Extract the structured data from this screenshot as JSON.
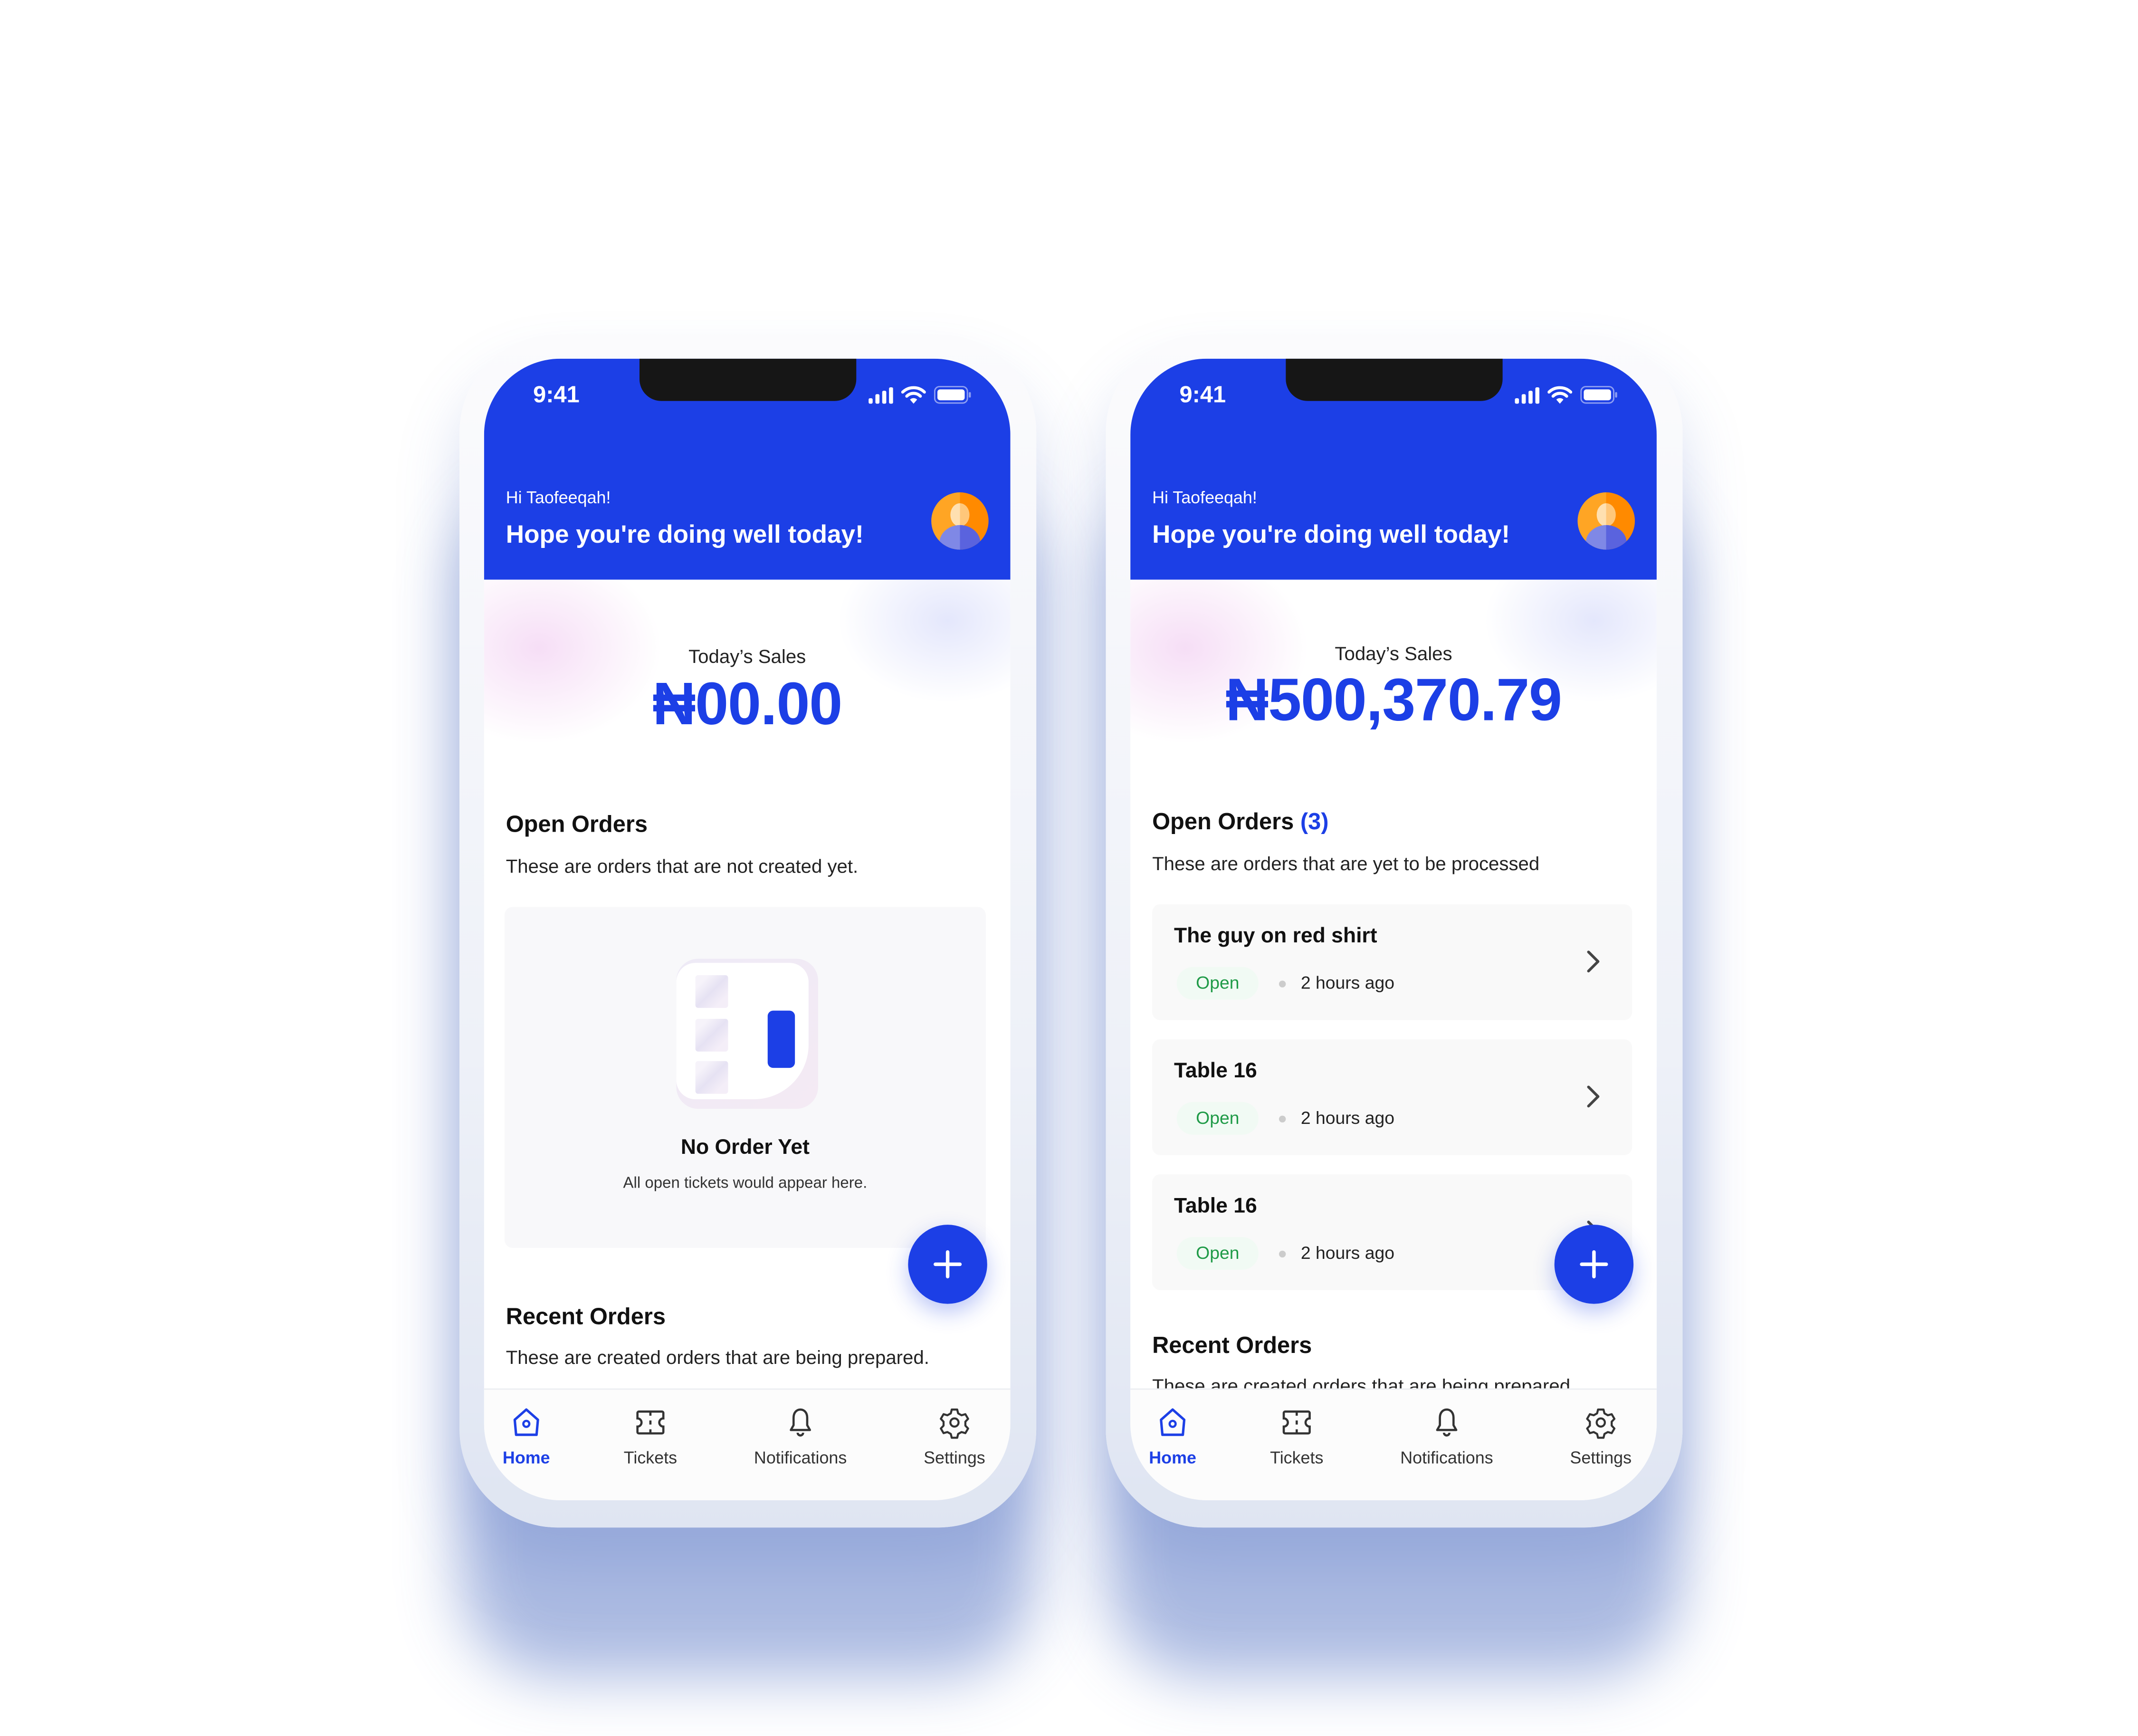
{
  "colors": {
    "brand": "#1c3fe6",
    "open_badge_text": "#1f9a47",
    "open_badge_bg": "#f1faf4"
  },
  "phones": [
    {
      "status_time": "9:41",
      "greeting": "Hi Taofeeqah!",
      "headline": "Hope you're doing well today!",
      "sales_label": "Today’s Sales",
      "sales_amount": "₦00.00",
      "open_orders": {
        "title": "Open Orders",
        "count": "",
        "subtitle": "These are orders that are not created yet."
      },
      "empty_state": {
        "title": "No Order Yet",
        "subtitle": "All open tickets would appear here."
      },
      "recent_orders": {
        "title": "Recent Orders",
        "subtitle": "These are created orders that are being prepared."
      },
      "nav": [
        {
          "label": "Home",
          "icon": "home-icon",
          "active": true
        },
        {
          "label": "Tickets",
          "icon": "ticket-icon"
        },
        {
          "label": "Notifications",
          "icon": "bell-icon"
        },
        {
          "label": "Settings",
          "icon": "gear-icon"
        }
      ]
    },
    {
      "status_time": "9:41",
      "greeting": "Hi Taofeeqah!",
      "headline": "Hope you're doing well today!",
      "sales_label": "Today’s Sales",
      "sales_amount": "₦500,370.79",
      "open_orders": {
        "title": "Open Orders",
        "count": "(3)",
        "subtitle": "These are orders that are yet to be processed"
      },
      "orders": [
        {
          "name": "The guy on red shirt",
          "status": "Open",
          "time": "2 hours ago"
        },
        {
          "name": "Table 16",
          "status": "Open",
          "time": "2 hours ago"
        },
        {
          "name": "Table 16",
          "status": "Open",
          "time": "2 hours ago"
        }
      ],
      "recent_orders": {
        "title": "Recent Orders",
        "subtitle": "These are created orders that are being prepared."
      },
      "nav": [
        {
          "label": "Home",
          "icon": "home-icon",
          "active": true
        },
        {
          "label": "Tickets",
          "icon": "ticket-icon"
        },
        {
          "label": "Notifications",
          "icon": "bell-icon"
        },
        {
          "label": "Settings",
          "icon": "gear-icon"
        }
      ]
    }
  ]
}
